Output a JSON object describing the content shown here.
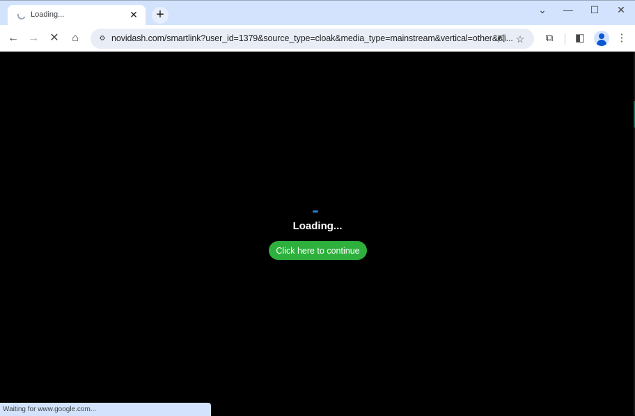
{
  "browser": {
    "tab": {
      "title": "Loading...",
      "close_glyph": "✕",
      "loading": true
    },
    "new_tab_glyph": "+",
    "window_controls": {
      "tab_search": "⌄",
      "minimize": "—",
      "maximize": "☐",
      "close": "✕"
    },
    "nav": {
      "back": "←",
      "forward": "→",
      "stop": "✕",
      "home": "⌂"
    },
    "omnibox": {
      "site_info_glyph": "⚙",
      "url": "novidash.com/smartlink?user_id=1379&source_type=cloak&media_type=mainstream&vertical=other&cli...",
      "share_glyph": "⇱",
      "bookmark_glyph": "☆"
    },
    "toolbar_icons": {
      "extensions": "⧉",
      "side_panel": "◧",
      "menu": "⋮"
    },
    "status_bar": "Waiting for www.google.com..."
  },
  "page": {
    "loading_text": "Loading...",
    "continue_button": "Click here to continue",
    "accent_color": "#2db13c"
  }
}
